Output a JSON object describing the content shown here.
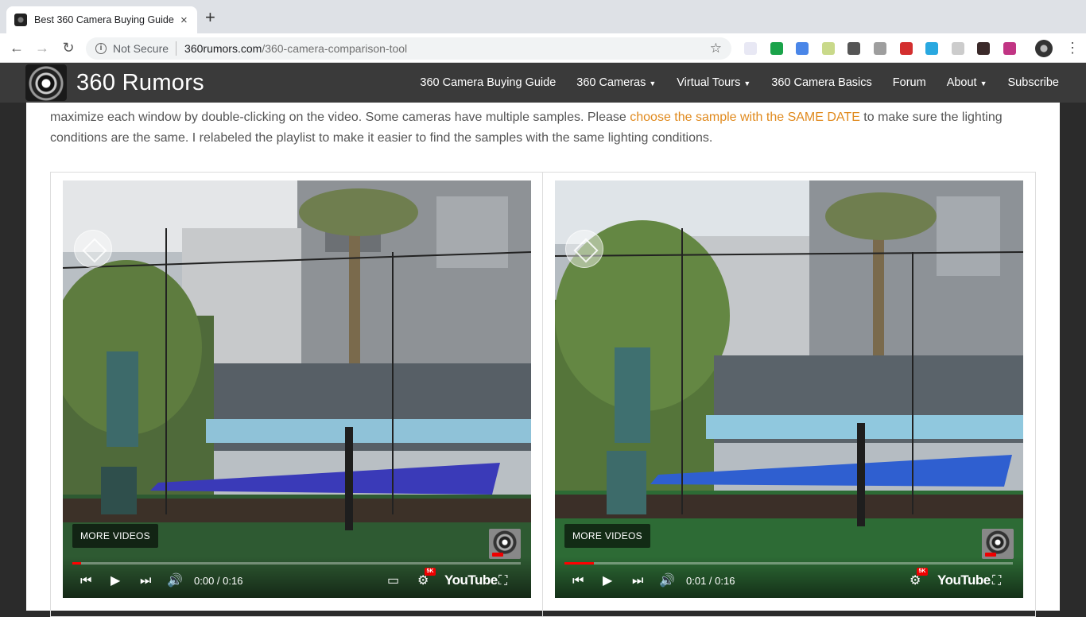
{
  "browser": {
    "tab_title": "Best 360 Camera Buying Guide",
    "close_glyph": "×",
    "new_tab_glyph": "+",
    "back_glyph": "←",
    "forward_glyph": "→",
    "reload_glyph": "↻",
    "info_glyph": "i",
    "security_label": "Not Secure",
    "url_host": "360rumors.com",
    "url_path": "/360-camera-comparison-tool",
    "bookmark_glyph": "☆",
    "menu_glyph": "⋮",
    "extensions": [
      {
        "name": "rainbow-extension-icon",
        "color": "#e8e8f4"
      },
      {
        "name": "checkmark-extension-icon",
        "color": "#1aa34a"
      },
      {
        "name": "translate-extension-icon",
        "color": "#4a86e8"
      },
      {
        "name": "notes-extension-icon",
        "color": "#c9d98a"
      },
      {
        "name": "shield-extension-icon",
        "color": "#555555"
      },
      {
        "name": "tab-extension-icon",
        "color": "#9e9e9e"
      },
      {
        "name": "bh-extension-icon",
        "color": "#d32f2f"
      },
      {
        "name": "iq-extension-icon",
        "color": "#29a8e0"
      },
      {
        "name": "grid-extension-icon",
        "color": "#cccccc"
      },
      {
        "name": "k-extension-icon",
        "color": "#3b2a2a"
      },
      {
        "name": "instagram-extension-icon",
        "color": "#c13584"
      }
    ]
  },
  "site": {
    "name": "360 Rumors",
    "nav": [
      {
        "label": "360 Camera Buying Guide",
        "dropdown": false
      },
      {
        "label": "360 Cameras",
        "dropdown": true
      },
      {
        "label": "Virtual Tours",
        "dropdown": true
      },
      {
        "label": "360 Camera Basics",
        "dropdown": false
      },
      {
        "label": "Forum",
        "dropdown": false
      },
      {
        "label": "About",
        "dropdown": true
      },
      {
        "label": "Subscribe",
        "dropdown": false
      }
    ],
    "caret_glyph": "▼"
  },
  "article": {
    "text_before": "maximize each window by double-clicking on the video.  Some cameras have multiple samples. Please ",
    "link_text": "choose the sample with the SAME DATE",
    "text_after": " to make sure the lighting conditions are the same.  I relabeled the playlist to make it easier to find the samples with the same lighting conditions."
  },
  "players": [
    {
      "more_videos": "MORE VIDEOS",
      "time": "0:00 / 0:16",
      "progress": 0.02,
      "logo": "YouTube",
      "hd_badge": "5K",
      "has_captions": true
    },
    {
      "more_videos": "MORE VIDEOS",
      "time": "0:01 / 0:16",
      "progress": 0.066,
      "logo": "YouTube",
      "hd_badge": "5K",
      "has_captions": false
    }
  ],
  "player_glyphs": {
    "prev": "⏮",
    "play": "▶",
    "next": "⏭",
    "volume": "🔊",
    "captions": "▭",
    "settings": "⚙",
    "fullscreen": "⛶"
  },
  "colors": {
    "header_bg": "#3a3a3a",
    "link_orange": "#e08a1e",
    "progress_red": "#ff0000"
  }
}
